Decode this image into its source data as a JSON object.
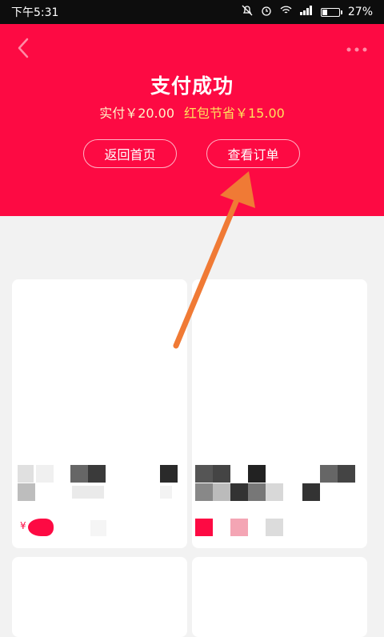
{
  "status_bar": {
    "time": "下午5:31",
    "battery": "27%",
    "icons": [
      "mute-icon",
      "alarm-icon",
      "wifi-icon",
      "signal-icon",
      "battery-icon"
    ]
  },
  "header": {
    "title": "支付成功",
    "paid_text": "实付￥20.00",
    "saved_text": "红包节省￥15.00",
    "back_icon": "chevron-left-icon",
    "more_icon": "more-icon"
  },
  "buttons": {
    "home": "返回首页",
    "order": "查看订单"
  },
  "products": [
    {
      "price_symbol": "¥",
      "name_fragment": "..."
    },
    {
      "price_symbol": "",
      "name_fragment": "..."
    }
  ],
  "colors": {
    "header_bg": "#fd0a43",
    "page_bg": "#f2f2f2",
    "arrow": "#f07a35",
    "saved_text": "#ffe15c"
  }
}
